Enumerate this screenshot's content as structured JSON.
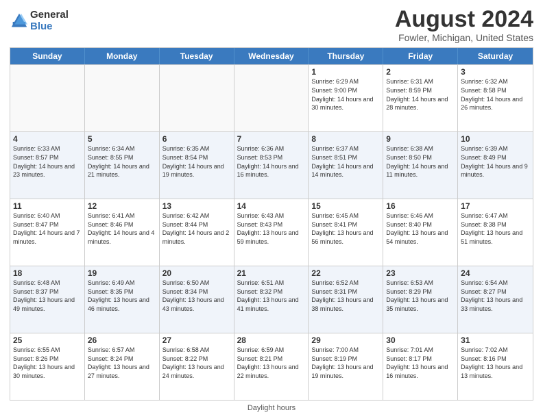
{
  "logo": {
    "general": "General",
    "blue": "Blue"
  },
  "title": "August 2024",
  "subtitle": "Fowler, Michigan, United States",
  "weekdays": [
    "Sunday",
    "Monday",
    "Tuesday",
    "Wednesday",
    "Thursday",
    "Friday",
    "Saturday"
  ],
  "weeks": [
    [
      {
        "day": "",
        "info": "",
        "empty": true
      },
      {
        "day": "",
        "info": "",
        "empty": true
      },
      {
        "day": "",
        "info": "",
        "empty": true
      },
      {
        "day": "",
        "info": "",
        "empty": true
      },
      {
        "day": "1",
        "info": "Sunrise: 6:29 AM\nSunset: 9:00 PM\nDaylight: 14 hours\nand 30 minutes."
      },
      {
        "day": "2",
        "info": "Sunrise: 6:31 AM\nSunset: 8:59 PM\nDaylight: 14 hours\nand 28 minutes."
      },
      {
        "day": "3",
        "info": "Sunrise: 6:32 AM\nSunset: 8:58 PM\nDaylight: 14 hours\nand 26 minutes."
      }
    ],
    [
      {
        "day": "4",
        "info": "Sunrise: 6:33 AM\nSunset: 8:57 PM\nDaylight: 14 hours\nand 23 minutes."
      },
      {
        "day": "5",
        "info": "Sunrise: 6:34 AM\nSunset: 8:55 PM\nDaylight: 14 hours\nand 21 minutes."
      },
      {
        "day": "6",
        "info": "Sunrise: 6:35 AM\nSunset: 8:54 PM\nDaylight: 14 hours\nand 19 minutes."
      },
      {
        "day": "7",
        "info": "Sunrise: 6:36 AM\nSunset: 8:53 PM\nDaylight: 14 hours\nand 16 minutes."
      },
      {
        "day": "8",
        "info": "Sunrise: 6:37 AM\nSunset: 8:51 PM\nDaylight: 14 hours\nand 14 minutes."
      },
      {
        "day": "9",
        "info": "Sunrise: 6:38 AM\nSunset: 8:50 PM\nDaylight: 14 hours\nand 11 minutes."
      },
      {
        "day": "10",
        "info": "Sunrise: 6:39 AM\nSunset: 8:49 PM\nDaylight: 14 hours\nand 9 minutes."
      }
    ],
    [
      {
        "day": "11",
        "info": "Sunrise: 6:40 AM\nSunset: 8:47 PM\nDaylight: 14 hours\nand 7 minutes."
      },
      {
        "day": "12",
        "info": "Sunrise: 6:41 AM\nSunset: 8:46 PM\nDaylight: 14 hours\nand 4 minutes."
      },
      {
        "day": "13",
        "info": "Sunrise: 6:42 AM\nSunset: 8:44 PM\nDaylight: 14 hours\nand 2 minutes."
      },
      {
        "day": "14",
        "info": "Sunrise: 6:43 AM\nSunset: 8:43 PM\nDaylight: 13 hours\nand 59 minutes."
      },
      {
        "day": "15",
        "info": "Sunrise: 6:45 AM\nSunset: 8:41 PM\nDaylight: 13 hours\nand 56 minutes."
      },
      {
        "day": "16",
        "info": "Sunrise: 6:46 AM\nSunset: 8:40 PM\nDaylight: 13 hours\nand 54 minutes."
      },
      {
        "day": "17",
        "info": "Sunrise: 6:47 AM\nSunset: 8:38 PM\nDaylight: 13 hours\nand 51 minutes."
      }
    ],
    [
      {
        "day": "18",
        "info": "Sunrise: 6:48 AM\nSunset: 8:37 PM\nDaylight: 13 hours\nand 49 minutes."
      },
      {
        "day": "19",
        "info": "Sunrise: 6:49 AM\nSunset: 8:35 PM\nDaylight: 13 hours\nand 46 minutes."
      },
      {
        "day": "20",
        "info": "Sunrise: 6:50 AM\nSunset: 8:34 PM\nDaylight: 13 hours\nand 43 minutes."
      },
      {
        "day": "21",
        "info": "Sunrise: 6:51 AM\nSunset: 8:32 PM\nDaylight: 13 hours\nand 41 minutes."
      },
      {
        "day": "22",
        "info": "Sunrise: 6:52 AM\nSunset: 8:31 PM\nDaylight: 13 hours\nand 38 minutes."
      },
      {
        "day": "23",
        "info": "Sunrise: 6:53 AM\nSunset: 8:29 PM\nDaylight: 13 hours\nand 35 minutes."
      },
      {
        "day": "24",
        "info": "Sunrise: 6:54 AM\nSunset: 8:27 PM\nDaylight: 13 hours\nand 33 minutes."
      }
    ],
    [
      {
        "day": "25",
        "info": "Sunrise: 6:55 AM\nSunset: 8:26 PM\nDaylight: 13 hours\nand 30 minutes."
      },
      {
        "day": "26",
        "info": "Sunrise: 6:57 AM\nSunset: 8:24 PM\nDaylight: 13 hours\nand 27 minutes."
      },
      {
        "day": "27",
        "info": "Sunrise: 6:58 AM\nSunset: 8:22 PM\nDaylight: 13 hours\nand 24 minutes."
      },
      {
        "day": "28",
        "info": "Sunrise: 6:59 AM\nSunset: 8:21 PM\nDaylight: 13 hours\nand 22 minutes."
      },
      {
        "day": "29",
        "info": "Sunrise: 7:00 AM\nSunset: 8:19 PM\nDaylight: 13 hours\nand 19 minutes."
      },
      {
        "day": "30",
        "info": "Sunrise: 7:01 AM\nSunset: 8:17 PM\nDaylight: 13 hours\nand 16 minutes."
      },
      {
        "day": "31",
        "info": "Sunrise: 7:02 AM\nSunset: 8:16 PM\nDaylight: 13 hours\nand 13 minutes."
      }
    ]
  ],
  "footer": "Daylight hours"
}
